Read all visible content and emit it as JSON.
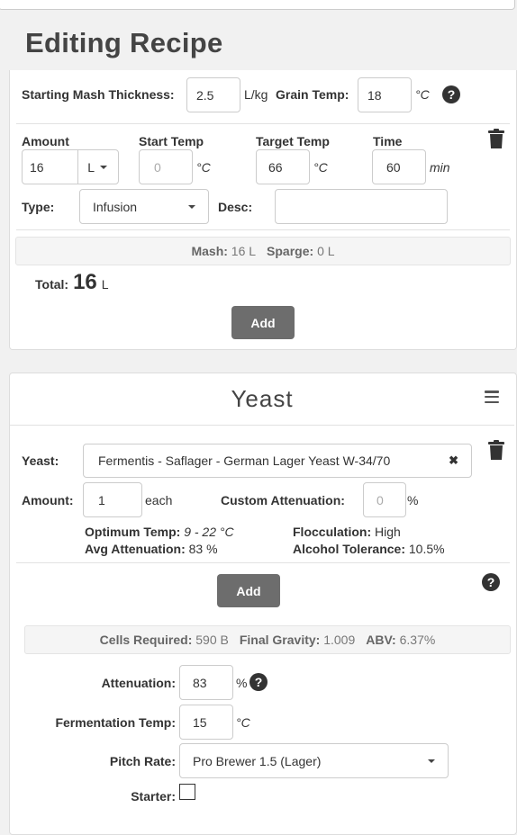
{
  "page_title": "Editing Recipe",
  "mash": {
    "thickness_label": "Starting Mash Thickness:",
    "thickness_value": "2.5",
    "thickness_unit": "L/kg",
    "grain_temp_label": "Grain Temp:",
    "grain_temp_value": "18",
    "grain_temp_unit": "°C",
    "step": {
      "amount_label": "Amount",
      "amount_value": "16",
      "amount_unit": "L",
      "start_temp_label": "Start Temp",
      "start_temp_placeholder": "0",
      "start_temp_unit": "°C",
      "target_temp_label": "Target Temp",
      "target_temp_value": "66",
      "target_temp_unit": "°C",
      "time_label": "Time",
      "time_value": "60",
      "time_unit": "min",
      "type_label": "Type:",
      "type_value": "Infusion",
      "desc_label": "Desc:",
      "desc_value": ""
    },
    "summary": {
      "mash_label": "Mash:",
      "mash_value": "16 L",
      "sparge_label": "Sparge:",
      "sparge_value": "0 L"
    },
    "total_label": "Total:",
    "total_value": "16",
    "total_unit": "L",
    "add_label": "Add"
  },
  "yeast": {
    "title": "Yeast",
    "yeast_label": "Yeast:",
    "yeast_value": "Fermentis - Saflager - German Lager Yeast W-34/70",
    "clear_glyph": "✖",
    "amount_label": "Amount:",
    "amount_value": "1",
    "amount_unit": "each",
    "custom_atten_label": "Custom Attenuation:",
    "custom_atten_placeholder": "0",
    "custom_atten_unit": "%",
    "optimum_temp_label": "Optimum Temp:",
    "optimum_temp_value": "9 - 22 °C",
    "flocculation_label": "Flocculation:",
    "flocculation_value": "High",
    "avg_atten_label": "Avg Attenuation:",
    "avg_atten_value": "83 %",
    "alcohol_tol_label": "Alcohol Tolerance:",
    "alcohol_tol_value": "10.5%",
    "add_label": "Add",
    "summary": {
      "cells_label": "Cells Required:",
      "cells_value": "590 B",
      "fg_label": "Final Gravity:",
      "fg_value": "1.009",
      "abv_label": "ABV:",
      "abv_value": "6.37%"
    },
    "attenuation_label": "Attenuation:",
    "attenuation_value": "83",
    "attenuation_unit": "%",
    "ferm_temp_label": "Fermentation Temp:",
    "ferm_temp_value": "15",
    "ferm_temp_unit": "°C",
    "pitch_rate_label": "Pitch Rate:",
    "pitch_rate_value": "Pro Brewer 1.5 (Lager)",
    "starter_label": "Starter:",
    "starter_checked": false
  },
  "help_glyph": "?",
  "icons": {
    "help": "help-icon",
    "trash": "trash-icon",
    "menu": "hamburger-menu-icon",
    "caret": "chevron-down-icon",
    "clear": "close-icon"
  },
  "colors": {
    "background": "#f1f1f1",
    "button": "#6d6d6d",
    "text": "#333333"
  }
}
